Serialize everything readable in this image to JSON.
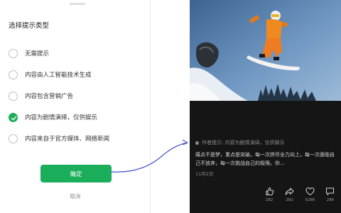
{
  "dialog": {
    "title": "选择提示类型",
    "options": [
      {
        "label": "无需提示",
        "checked": false
      },
      {
        "label": "内容由人工智能技术生成",
        "checked": false
      },
      {
        "label": "内容包含营销广告",
        "checked": false
      },
      {
        "label": "内容为剧情演绎，仅供娱乐",
        "checked": true
      },
      {
        "label": "内容来自于官方媒体、网络新闻",
        "checked": false
      }
    ],
    "confirm_label": "确定",
    "cancel_label": "取消"
  },
  "post": {
    "notice": "作者提示: 内容为剧情演绎，仅供娱乐",
    "description": "痛点不是梦，重点是突破。每一次拼尽全力向上，每一次面临自己不放弃，每一次挑战自己的极限。你...",
    "date": "11月2日",
    "actions": [
      {
        "icon": "like-icon",
        "count": "282"
      },
      {
        "icon": "share-icon",
        "count": "282"
      },
      {
        "icon": "favorite-icon",
        "count": "5286"
      },
      {
        "icon": "comment-icon",
        "count": "286"
      }
    ]
  },
  "colors": {
    "accent": "#1aad5a",
    "dark_bg": "#151515"
  }
}
